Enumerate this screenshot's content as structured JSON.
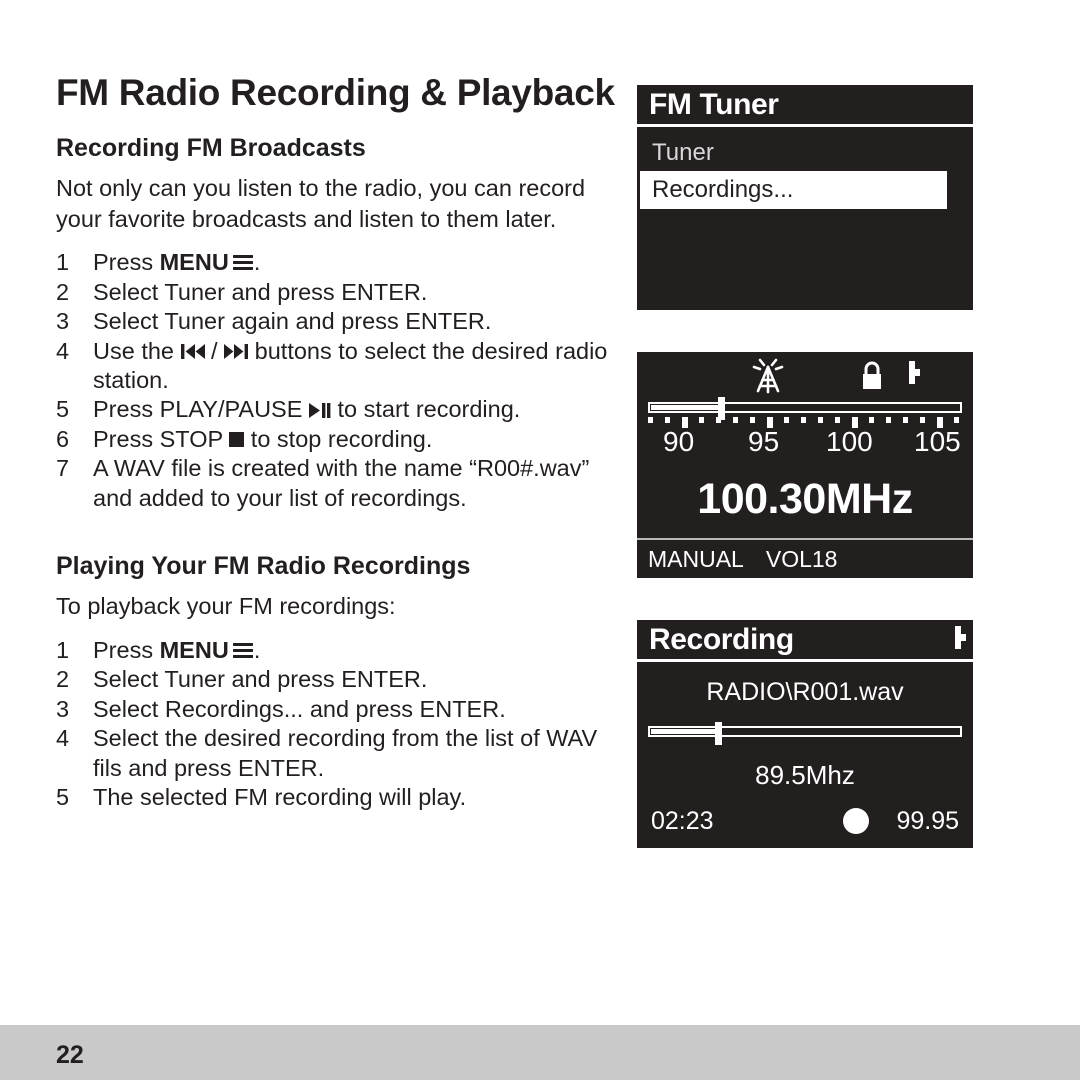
{
  "page": {
    "title": "FM Radio Recording & Playback",
    "number": "22"
  },
  "sections": [
    {
      "heading": "Recording FM Broadcasts",
      "intro": "Not only can you listen to the radio, you can record your favorite broadcasts and listen to them later.",
      "steps": [
        {
          "num": "1",
          "pre": "Press ",
          "bold": "MENU",
          "icon": "menu-icon",
          "post": "."
        },
        {
          "num": "2",
          "pre": "Select Tuner and press ENTER.",
          "bold": "",
          "icon": "",
          "post": ""
        },
        {
          "num": "3",
          "pre": "Select Tuner again and press ENTER.",
          "bold": "",
          "icon": "",
          "post": ""
        },
        {
          "num": "4",
          "pre": "Use the ",
          "bold": "",
          "icon": "prev-next-icon",
          "post": " buttons to select the desired radio station."
        },
        {
          "num": "5",
          "pre": "Press PLAY/PAUSE ",
          "bold": "",
          "icon": "play-pause-icon",
          "post": " to start recording."
        },
        {
          "num": "6",
          "pre": "Press STOP ",
          "bold": "",
          "icon": "stop-icon",
          "post": "  to stop recording."
        },
        {
          "num": "7",
          "pre": "A WAV file is created with the name “R00#.wav” and added to your list of recordings.",
          "bold": "",
          "icon": "",
          "post": ""
        }
      ]
    },
    {
      "heading": "Playing Your FM Radio Recordings",
      "intro": "To playback your FM recordings:",
      "steps": [
        {
          "num": "1",
          "pre": "Press ",
          "bold": "MENU",
          "icon": "menu-icon",
          "post": "."
        },
        {
          "num": "2",
          "pre": "Select Tuner and press ENTER.",
          "bold": "",
          "icon": "",
          "post": ""
        },
        {
          "num": "3",
          "pre": "Select Recordings... and press ENTER.",
          "bold": "",
          "icon": "",
          "post": ""
        },
        {
          "num": "4",
          "pre": "Select the desired recording from the list of WAV fils and press ENTER.",
          "bold": "",
          "icon": "",
          "post": ""
        },
        {
          "num": "5",
          "pre": "The selected FM recording will play.",
          "bold": "",
          "icon": "",
          "post": ""
        }
      ]
    }
  ],
  "screens": {
    "tuner_menu": {
      "title": "FM Tuner",
      "items": [
        {
          "label": "Tuner",
          "selected": false
        },
        {
          "label": "Recordings...",
          "selected": true
        }
      ]
    },
    "tuner_display": {
      "icons": [
        "antenna-icon",
        "lock-icon",
        "battery-icon"
      ],
      "scale_labels": [
        "90",
        "95",
        "100",
        "105"
      ],
      "scale_position_pct": 22,
      "frequency": "100.30MHz",
      "mode": "MANUAL",
      "volume": "VOL18"
    },
    "recording": {
      "title": "Recording",
      "battery": "battery-icon",
      "file": "RADIO\\R001.wav",
      "progress_pct": 21,
      "frequency": "89.5Mhz",
      "elapsed": "02:23",
      "counter": "99.95",
      "record_indicator": "record-dot-icon"
    }
  },
  "colors": {
    "screen_background": "#231f1f",
    "screen_foreground": "#ffffff",
    "text": "#231f20",
    "footer_background": "#c9c9c9"
  }
}
